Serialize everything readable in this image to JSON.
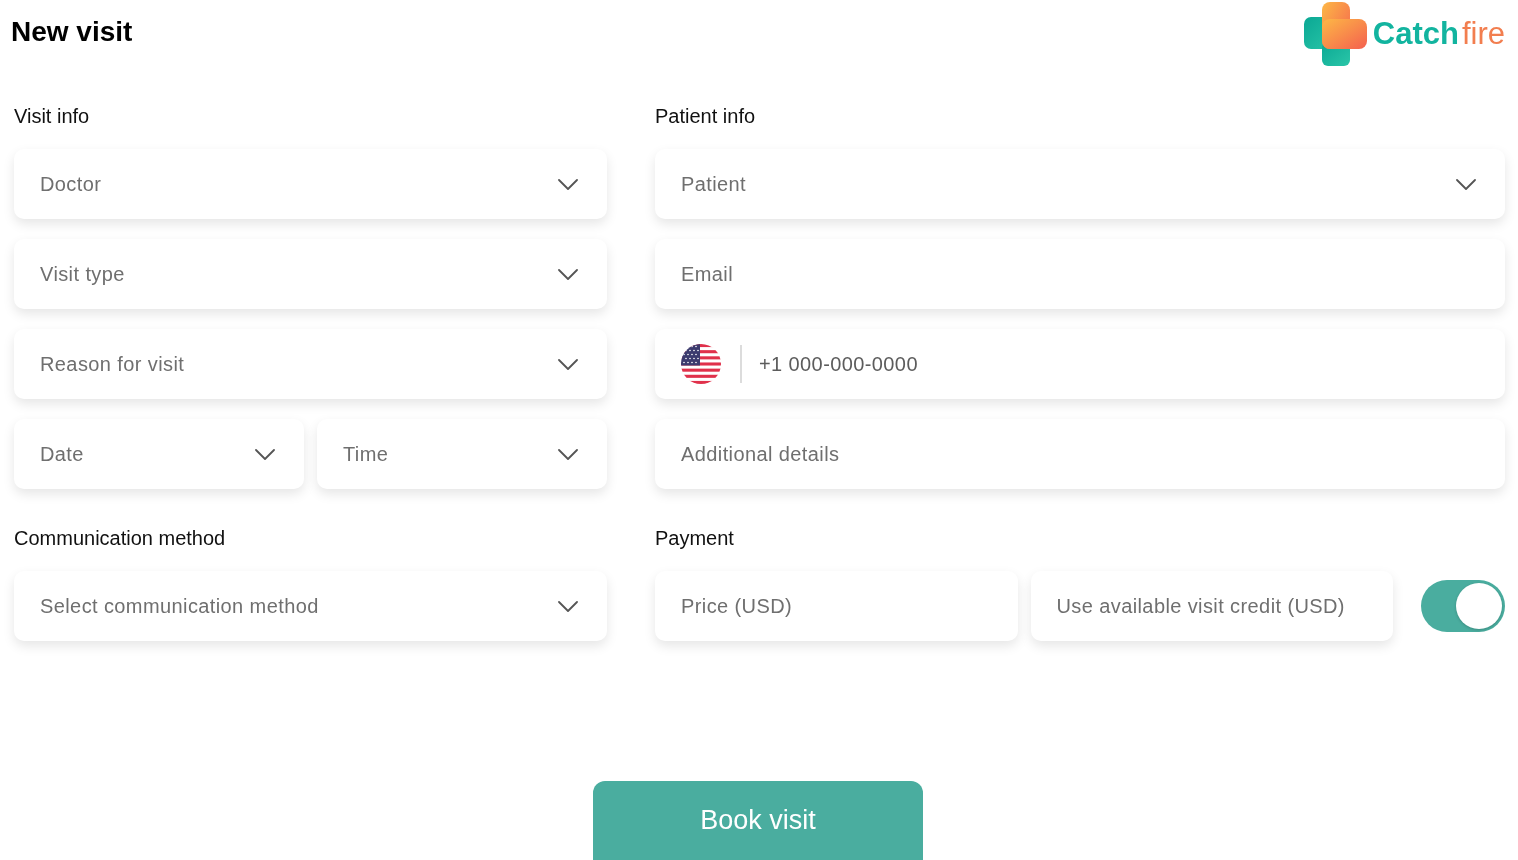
{
  "header": {
    "title": "New visit",
    "logo": {
      "parts": [
        {
          "text": "Catch",
          "color": "#12b49f"
        },
        {
          "text": "fire",
          "color": "#f27e4f"
        }
      ]
    }
  },
  "visit_info": {
    "heading": "Visit info",
    "rows": [
      {
        "fields": [
          {
            "kind": "dropdown",
            "placeholder": "Doctor"
          }
        ]
      },
      {
        "fields": [
          {
            "kind": "dropdown",
            "placeholder": "Visit type"
          }
        ]
      },
      {
        "fields": [
          {
            "kind": "dropdown",
            "placeholder": "Reason for visit"
          }
        ]
      },
      {
        "fields": [
          {
            "kind": "dropdown",
            "placeholder": "Date"
          },
          {
            "kind": "dropdown",
            "placeholder": "Time"
          }
        ]
      }
    ]
  },
  "patient_info": {
    "heading": "Patient info",
    "rows": [
      {
        "fields": [
          {
            "kind": "dropdown",
            "placeholder": "Patient"
          }
        ]
      },
      {
        "fields": [
          {
            "kind": "text",
            "placeholder": "Email"
          }
        ]
      },
      {
        "fields": [
          {
            "kind": "phone",
            "placeholder": "+1 000-000-0000"
          }
        ]
      },
      {
        "fields": [
          {
            "kind": "text",
            "placeholder": "Additional details"
          }
        ]
      }
    ]
  },
  "communication": {
    "heading": "Communication method",
    "rows": [
      {
        "fields": [
          {
            "kind": "dropdown",
            "placeholder": "Select communication method"
          }
        ]
      }
    ]
  },
  "payment": {
    "heading": "Payment",
    "rows": [
      {
        "fields": [
          {
            "kind": "text",
            "placeholder": "Price (USD)"
          },
          {
            "kind": "text",
            "placeholder": "Use available visit credit (USD)"
          },
          {
            "kind": "toggle",
            "on": true
          }
        ]
      }
    ]
  },
  "book_button": {
    "label": "Book visit"
  }
}
